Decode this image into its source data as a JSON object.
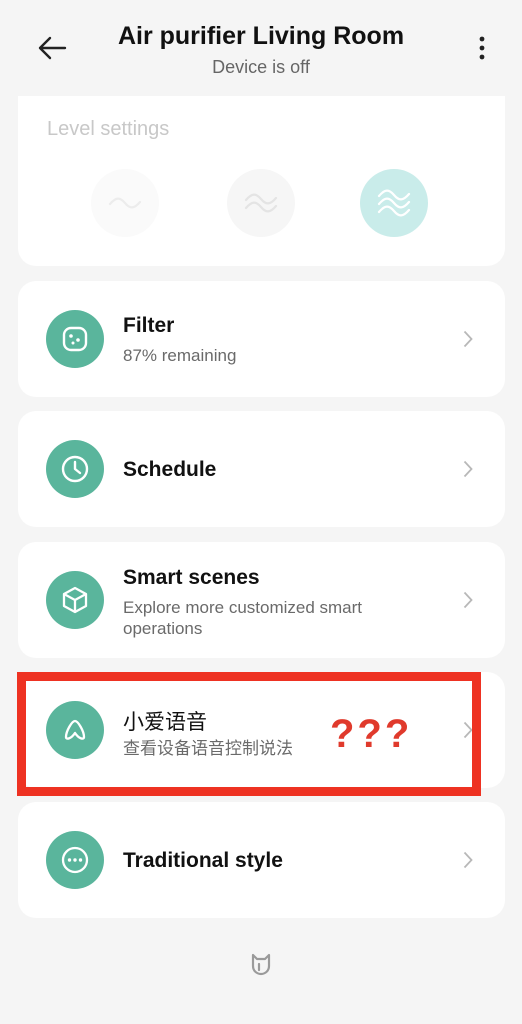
{
  "header": {
    "title": "Air purifier Living Room",
    "status": "Device is off"
  },
  "level": {
    "title": "Level settings",
    "selected_index": 2,
    "accent_color": "#c9ecea"
  },
  "rows": [
    {
      "icon": "filter-icon",
      "title": "Filter",
      "subtitle": "87% remaining"
    },
    {
      "icon": "clock-icon",
      "title": "Schedule",
      "subtitle": ""
    },
    {
      "icon": "cube-icon",
      "title": "Smart scenes",
      "subtitle": "Explore more customized smart operations"
    },
    {
      "icon": "voice-assistant-icon",
      "title": "小爱语音",
      "subtitle": "查看设备语音控制说法"
    },
    {
      "icon": "more-dots-icon",
      "title": "Traditional style",
      "subtitle": ""
    }
  ],
  "annotation": {
    "text": "???",
    "color": "#ee3222"
  },
  "icon_color": "#5ab59c"
}
